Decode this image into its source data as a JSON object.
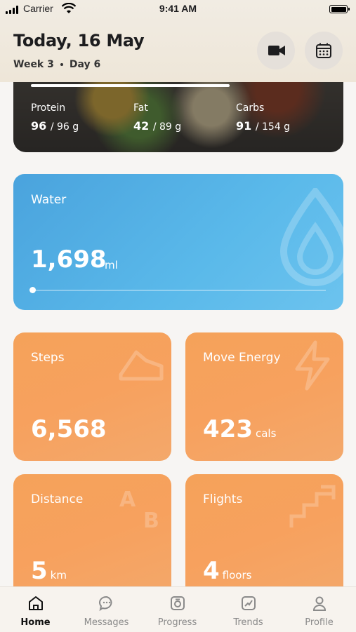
{
  "status": {
    "carrier": "Carrier",
    "time": "9:41 AM"
  },
  "header": {
    "title": "Today, 16 May",
    "week": "Week 3",
    "day": "Day 6",
    "buttons": [
      "video-camera-icon",
      "calendar-icon"
    ]
  },
  "macros": [
    {
      "label": "Protein",
      "value": "96",
      "total": "/ 96 g"
    },
    {
      "label": "Fat",
      "value": "42",
      "total": "/ 89 g"
    },
    {
      "label": "Carbs",
      "value": "91",
      "total": "/ 154 g"
    }
  ],
  "water": {
    "label": "Water",
    "value": "1,698",
    "unit": "ml"
  },
  "tiles": [
    {
      "label": "Steps",
      "value": "6,568",
      "unit": ""
    },
    {
      "label": "Move Energy",
      "value": "423",
      "unit": "cals"
    },
    {
      "label": "Distance",
      "value": "5",
      "unit": "km"
    },
    {
      "label": "Flights",
      "value": "4",
      "unit": "floors"
    }
  ],
  "tabs": [
    {
      "label": "Home",
      "icon": "home-icon",
      "active": true
    },
    {
      "label": "Messages",
      "icon": "messages-icon",
      "active": false
    },
    {
      "label": "Progress",
      "icon": "progress-icon",
      "active": false
    },
    {
      "label": "Trends",
      "icon": "trends-icon",
      "active": false
    },
    {
      "label": "Profile",
      "icon": "profile-icon",
      "active": false
    }
  ],
  "colors": {
    "water": "#5ab9ea",
    "tile": "#f5a25a",
    "header": "#efe8dc"
  }
}
